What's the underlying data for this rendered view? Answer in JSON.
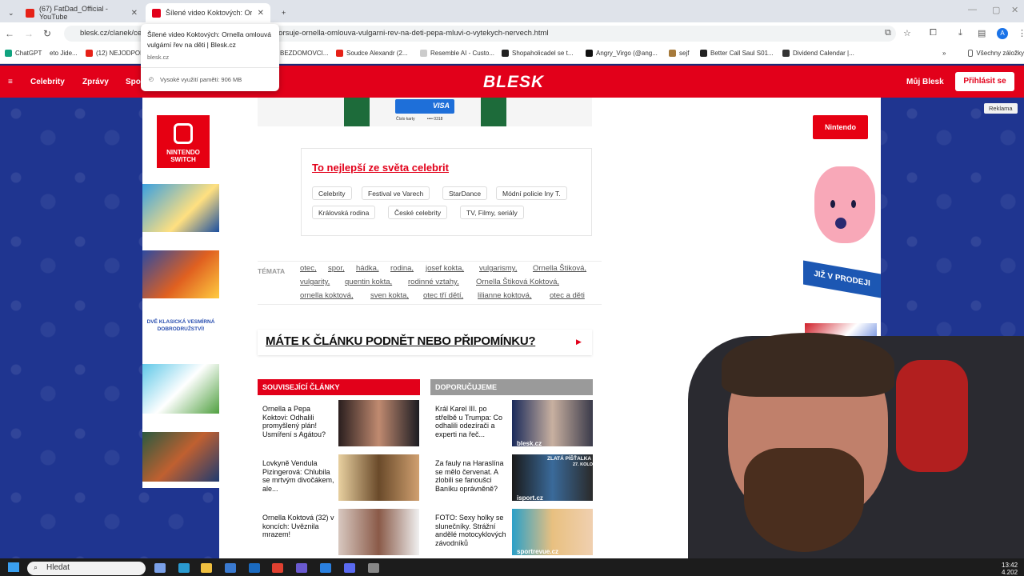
{
  "browser": {
    "tabs": [
      {
        "title": "(67) FatDad_Official - YouTube"
      },
      {
        "title": "Šílené video Koktových: Ornella"
      }
    ],
    "url": "blesk.cz/clanek/celebrity-...eo-z-domacnosti-koktovych-pohorsuje-ornella-omlouva-vulgarni-rev-na-deti-pepa-mluvi-o-vytekych-nervech.html",
    "bookmarks": [
      "ChatGPT",
      "eto Jide...",
      "(12) NEJODPOL...",
      "BEZDOMOVCI...",
      "Soudce Alexandr (2...",
      "Resemble AI - Custo...",
      "Shopaholicadel se t...",
      "Angry_Virgo (@ang...",
      "sejf",
      "Better Call Saul S01...",
      "Dividend Calendar |...",
      "Všechny záložky"
    ]
  },
  "tooltip": {
    "title": "Šílené video Koktových: Ornella omlouvá vulgární řev na děti | Blesk.cz",
    "domain": "blesk.cz",
    "memory": "Vysoké využití paměti: 906 MB"
  },
  "blesk": {
    "nav": [
      "Celebrity",
      "Zprávy",
      "Spo"
    ],
    "logo": "BLESK",
    "my_blesk": "Můj Blesk",
    "login": "Přihlásit se",
    "reklama": "Reklama"
  },
  "ads": {
    "left_brand": "NINTENDO SWITCH",
    "left_text": "DVĚ KLASICKÁ VESMÍRNÁ DOBRODRUŽSTVÍ!",
    "right_brand": "Nintendo",
    "right_text": "JIŽ V PRODEJI",
    "visa": "VISA",
    "card_label": "Číslo karty",
    "card_digits": "•••• 0318"
  },
  "celeb_box": {
    "title": "To nejlepší ze světa celebrit",
    "chips": [
      "Celebrity",
      "Festival ve Varech",
      "StarDance",
      "Módní policie Iny T.",
      "Královská rodina",
      "České celebrity",
      "TV, Filmy, seriály"
    ]
  },
  "topics": {
    "label": "TÉMATA",
    "tags": [
      "otec,",
      "spor,",
      "hádka,",
      "rodina,",
      "josef kokta,",
      "vulgarismy,",
      "Ornella Štiková,",
      "vulgarity,",
      "quentin kokta,",
      "rodinné vztahy,",
      "Ornella Štiková Koktová,",
      "ornella koktová,",
      "sven kokta,",
      "otec tří dětí,",
      "lilianne koktová,",
      "otec a děti"
    ]
  },
  "feedback": {
    "text": "MÁTE K ČLÁNKU PODNĚT NEBO PŘIPOMÍNKU?"
  },
  "related": {
    "heading": "SOUVISEJÍCÍ ČLÁNKY",
    "articles": [
      "Ornella a Pepa Koktovi: Odhalili promyšlený plán! Usmíření s Agátou?",
      "Lovkyně Vendula Pizingerová: Chlubila se mrtvým divočákem, ale...",
      "Ornella Koktová (32) v koncích: Uvěznila mrazem!"
    ]
  },
  "recommended": {
    "heading": "DOPORUČUJEME",
    "articles": [
      {
        "text": "Král Karel III. po střelbě u Trumpa: Co odhalili odezírači a experti na řeč...",
        "source": "blesk.cz"
      },
      {
        "text": "Za fauly na Haraslína se mělo červenat. A zlobili se fanoušci Baníku oprávněně?",
        "source": "isport.cz"
      },
      {
        "text": "FOTO: Sexy holky se slunečníky. Strážní andělé motocyklových závodníků",
        "source": "sportrevue.cz"
      }
    ],
    "badge": "ZLATÁ PÍŠŤALKA",
    "badge_sub": "27. KOLO"
  },
  "taskbar": {
    "search": "Hledat",
    "time": "13:42",
    "date": "4.202"
  }
}
